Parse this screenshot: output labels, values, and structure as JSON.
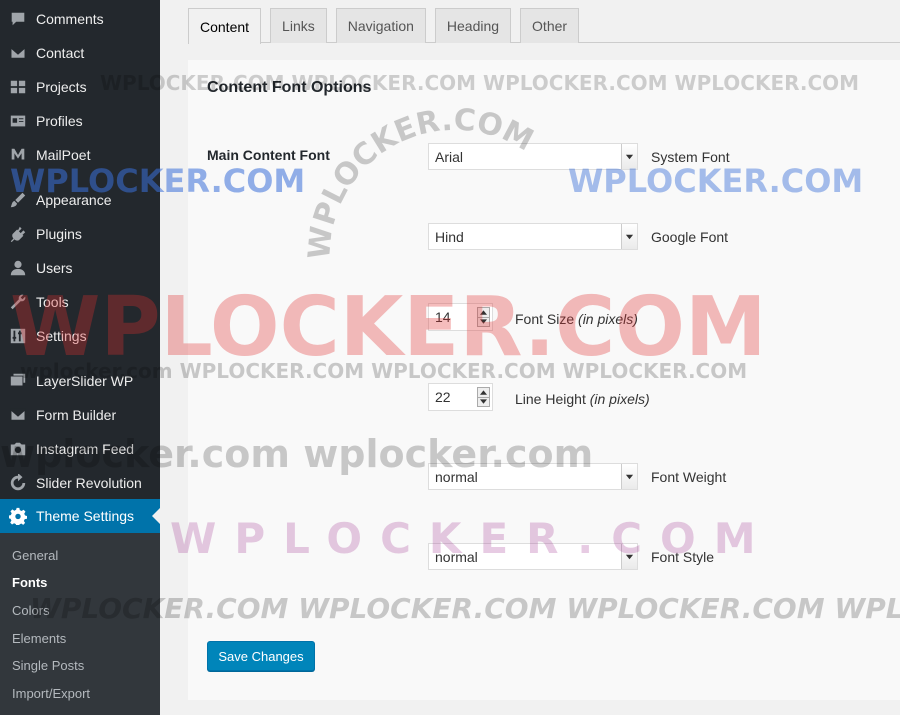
{
  "sidebar": {
    "items": [
      {
        "label": "Comments",
        "icon": "comments-icon"
      },
      {
        "label": "Contact",
        "icon": "envelope-icon"
      },
      {
        "label": "Projects",
        "icon": "portfolio-icon"
      },
      {
        "label": "Profiles",
        "icon": "id-card-icon"
      },
      {
        "label": "MailPoet",
        "icon": "mailpoet-icon"
      },
      {
        "label": "Appearance",
        "icon": "paintbrush-icon"
      },
      {
        "label": "Plugins",
        "icon": "plugin-icon"
      },
      {
        "label": "Users",
        "icon": "user-icon"
      },
      {
        "label": "Tools",
        "icon": "wrench-icon"
      },
      {
        "label": "Settings",
        "icon": "sliders-icon"
      },
      {
        "label": "LayerSlider WP",
        "icon": "layers-icon"
      },
      {
        "label": "Form Builder",
        "icon": "envelope-icon"
      },
      {
        "label": "Instagram Feed",
        "icon": "camera-icon"
      },
      {
        "label": "Slider Revolution",
        "icon": "refresh-icon"
      },
      {
        "label": "Theme Settings",
        "icon": "gear-icon"
      }
    ],
    "submenu": [
      "General",
      "Fonts",
      "Colors",
      "Elements",
      "Single Posts",
      "Import/Export"
    ]
  },
  "tabs": [
    "Content",
    "Links",
    "Navigation",
    "Heading",
    "Other"
  ],
  "section": {
    "title": "Content Font Options",
    "field_label": "Main Content Font",
    "system_font": {
      "value": "Arial",
      "desc": "System Font"
    },
    "google_font": {
      "value": "Hind",
      "desc": "Google Font"
    },
    "font_size": {
      "value": "14",
      "desc": "Font Size",
      "unit": "(in pixels)"
    },
    "line_height": {
      "value": "22",
      "desc": "Line Height",
      "unit": "(in pixels)"
    },
    "font_weight": {
      "value": "normal",
      "desc": "Font Weight"
    },
    "font_style": {
      "value": "normal",
      "desc": "Font Style"
    }
  },
  "save_label": "Save Changes",
  "watermark": "WPLOCKER.COM",
  "colors": {
    "sidebar": "#23282d",
    "accent": "#0073aa",
    "button": "#0085ba"
  }
}
